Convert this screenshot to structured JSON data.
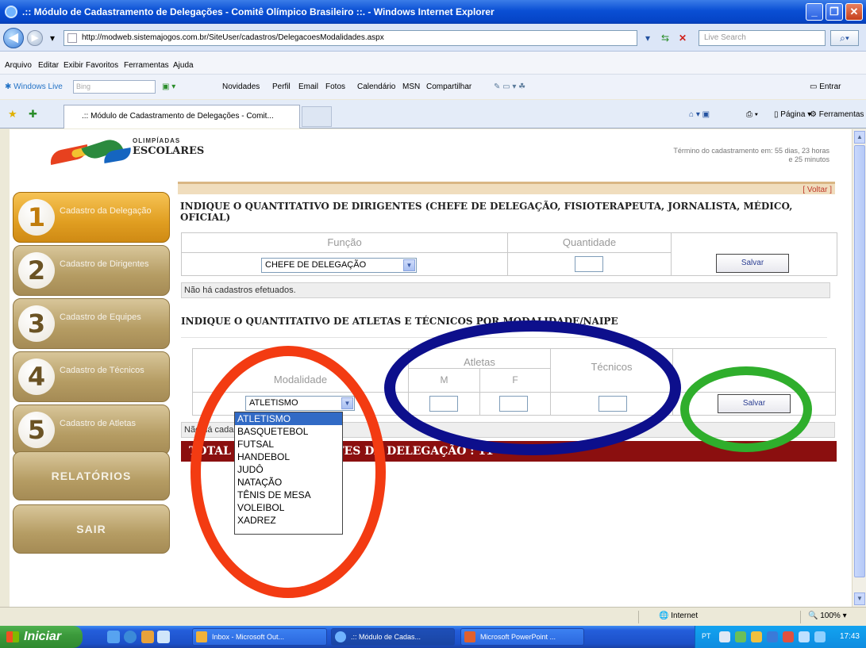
{
  "window": {
    "title": ".:: Módulo de Cadastramento de Delegações - Comitê Olímpico Brasileiro ::. - Windows Internet Explorer"
  },
  "addressbar": {
    "url": "http://modweb.sistemajogos.com.br/SiteUser/cadastros/DelegacoesModalidades.aspx",
    "search_placeholder": "Live Search"
  },
  "menu": [
    "Arquivo",
    "Editar",
    "Exibir",
    "Favoritos",
    "Ferramentas",
    "Ajuda"
  ],
  "live_toolbar": {
    "brand": "Windows Live",
    "search_placeholder": "Bing",
    "items": [
      "Novidades",
      "Perfil",
      "Email",
      "Fotos",
      "Calendário",
      "MSN",
      "Compartilhar"
    ],
    "signin": "Entrar"
  },
  "tabs": {
    "active": ".:: Módulo de Cadastramento de Delegações - Comit...",
    "right_tools": [
      "Página",
      "Ferramentas"
    ]
  },
  "header": {
    "logo_small": "OLIMPÍADAS",
    "logo_big": "ESCOLARES",
    "deadline_line1": "Término do cadastramento em: 55 dias, 23 horas",
    "deadline_line2": "e 25 minutos"
  },
  "sidebar": {
    "steps": [
      {
        "num": "1",
        "label": "Cadastro da Delegação",
        "active": true
      },
      {
        "num": "2",
        "label": "Cadastro de Dirigentes",
        "active": false
      },
      {
        "num": "3",
        "label": "Cadastro de Equipes",
        "active": false
      },
      {
        "num": "4",
        "label": "Cadastro de Técnicos",
        "active": false
      },
      {
        "num": "5",
        "label": "Cadastro de Atletas",
        "active": false
      }
    ],
    "relatorios": "RELATÓRIOS",
    "sair": "SAIR"
  },
  "main": {
    "voltar": "[ Voltar ]",
    "section1_title": "INDIQUE O QUANTITATIVO DE DIRIGENTES (CHEFE DE DELEGAÇÃO, FISIOTERAPEUTA, JORNALISTA, MÉDICO, OFICIAL)",
    "col_funcao": "Função",
    "col_quantidade": "Quantidade",
    "funcao_selected": "CHEFE DE DELEGAÇÃO",
    "save1": "Salvar",
    "no_records1": "Não há cadastros efetuados.",
    "section2_title": "INDIQUE O QUANTITATIVO DE ATLETAS E TÉCNICOS POR MODALIDADE/NAIPE",
    "col_modalidade": "Modalidade",
    "col_atletas": "Atletas",
    "col_m": "M",
    "col_f": "F",
    "col_tecnicos": "Técnicos",
    "modalidade_selected": "ATLETISMO",
    "save2": "Salvar",
    "no_records2": "Não há cadastros efetuados.",
    "total": "TOTAL DE PARTICIPANTES DA DELEGAÇÃO : 11",
    "modalidade_options": [
      "ATLETISMO",
      "BASQUETEBOL",
      "FUTSAL",
      "HANDEBOL",
      "JUDÔ",
      "NATAÇÃO",
      "TÊNIS DE MESA",
      "VOLEIBOL",
      "XADREZ"
    ]
  },
  "annotations": {
    "colors": {
      "red": "#f33b12",
      "blue": "#0d0f8c",
      "green": "#2fae2c"
    }
  },
  "statusbar": {
    "zone": "Internet",
    "zoom": "100%"
  },
  "taskbar": {
    "start": "Iniciar",
    "tasks": [
      "Inbox - Microsoft Out...",
      ".:: Módulo de Cadas...",
      "Microsoft PowerPoint ..."
    ],
    "lang": "PT",
    "clock": "17:43"
  }
}
